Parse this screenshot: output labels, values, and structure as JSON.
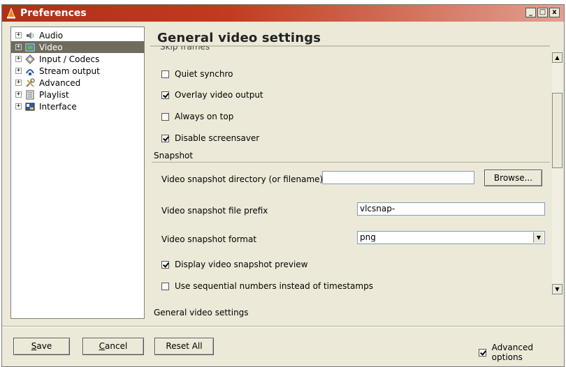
{
  "window": {
    "title": "Preferences",
    "controls": {
      "minimize": "_",
      "maximize": "□",
      "close": "x"
    }
  },
  "tree": {
    "items": [
      {
        "label": "Audio",
        "icon": "speaker-icon",
        "expander": "+"
      },
      {
        "label": "Video",
        "icon": "video-icon",
        "expander": "+",
        "selected": true
      },
      {
        "label": "Input / Codecs",
        "icon": "codec-icon",
        "expander": "+"
      },
      {
        "label": "Stream output",
        "icon": "stream-icon",
        "expander": "+"
      },
      {
        "label": "Advanced",
        "icon": "tools-icon",
        "expander": "+"
      },
      {
        "label": "Playlist",
        "icon": "playlist-icon",
        "expander": "+"
      },
      {
        "label": "Interface",
        "icon": "interface-icon",
        "expander": "+"
      }
    ]
  },
  "panel": {
    "title": "General video settings",
    "partial_label": "Skip frames",
    "checkboxes": [
      {
        "label": "Quiet synchro",
        "checked": false
      },
      {
        "label": "Overlay video output",
        "checked": true
      },
      {
        "label": "Always on top",
        "checked": false
      },
      {
        "label": "Disable screensaver",
        "checked": true
      }
    ],
    "snapshot": {
      "section_title": "Snapshot",
      "directory_label": "Video snapshot directory (or filename)",
      "directory_value": "",
      "browse_label": "Browse...",
      "prefix_label": "Video snapshot file prefix",
      "prefix_value": "vlcsnap-",
      "format_label": "Video snapshot format",
      "format_value": "png",
      "preview": {
        "label": "Display video snapshot preview",
        "checked": true
      },
      "sequential": {
        "label": "Use sequential numbers instead of timestamps",
        "checked": false
      }
    },
    "footer_label": "General video settings"
  },
  "buttons": {
    "save": {
      "text": "Save",
      "mnemonic": "S",
      "rest": "ave"
    },
    "cancel": {
      "text": "Cancel",
      "mnemonic": "C",
      "rest": "ancel"
    },
    "reset_all": "Reset All"
  },
  "advanced_options": {
    "label": "Advanced options",
    "checked": true
  }
}
